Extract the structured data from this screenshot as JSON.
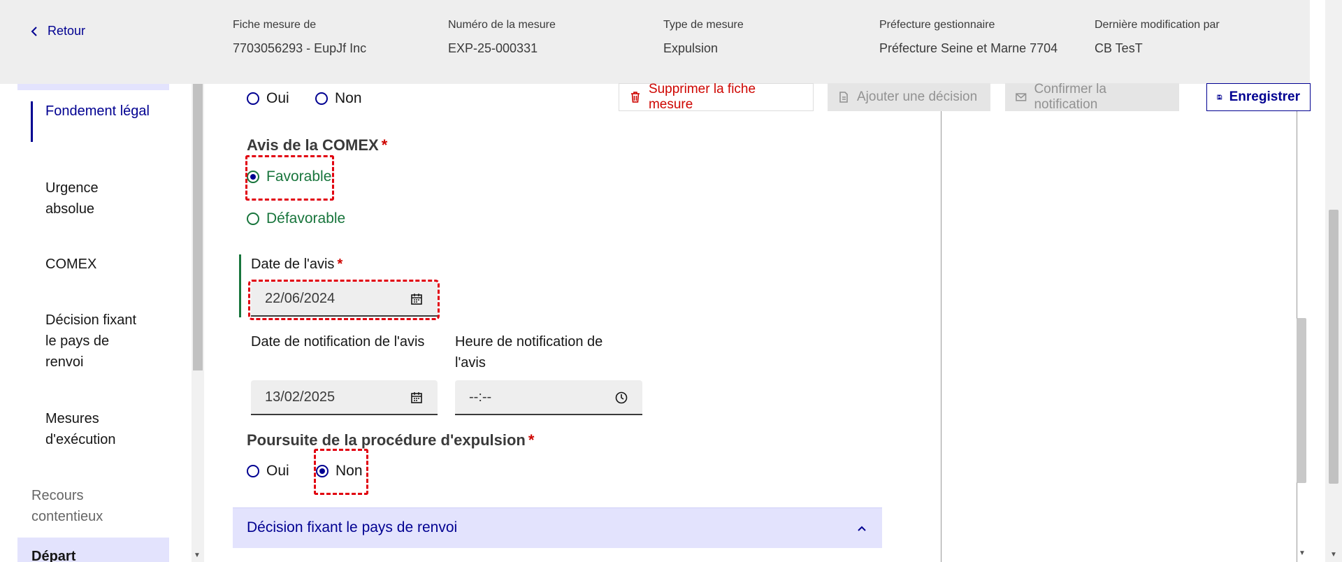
{
  "header": {
    "back_label": "Retour",
    "columns": [
      {
        "label": "Fiche mesure de",
        "value": "7703056293 - EupJf Inc"
      },
      {
        "label": "Numéro de la mesure",
        "value": "EXP-25-000331"
      },
      {
        "label": "Type de mesure",
        "value": "Expulsion"
      },
      {
        "label": "Préfecture gestionnaire",
        "value": "Préfecture Seine et Marne 7704"
      },
      {
        "label": "Dernière modification par",
        "value": "CB TesT"
      }
    ]
  },
  "sidebar": {
    "items": [
      {
        "label": "Fondement légal",
        "active": true
      },
      {
        "label": "Urgence absolue"
      },
      {
        "label": "COMEX"
      },
      {
        "label": "Décision fixant le pays de renvoi"
      },
      {
        "label": "Mesures d'exécution"
      }
    ],
    "section_recours": "Recours contentieux",
    "section_depart": "Départ"
  },
  "actions": {
    "delete": "Supprimer la fiche mesure",
    "add_decision": "Ajouter une décision",
    "confirm_notification": "Confirmer la notification",
    "save": "Enregistrer"
  },
  "form": {
    "top_radio": {
      "oui": "Oui",
      "non": "Non"
    },
    "comex_avis": {
      "legend": "Avis de la COMEX",
      "required_mark": "*",
      "options": [
        "Favorable",
        "Défavorable"
      ],
      "selected": "Favorable"
    },
    "date_avis": {
      "label": "Date de l'avis",
      "required_mark": "*",
      "value": "22/06/2024"
    },
    "date_notification": {
      "label": "Date de notification de l'avis",
      "value": "13/02/2025"
    },
    "heure_notification": {
      "label": "Heure de notification de l'avis",
      "value": "--:--"
    },
    "poursuite": {
      "legend": "Poursuite de la procédure d'expulsion",
      "required_mark": "*",
      "options": [
        "Oui",
        "Non"
      ],
      "selected": "Non"
    }
  },
  "accordion": {
    "title": "Décision fixant le pays de renvoi"
  },
  "colors": {
    "primary": "#000091",
    "success": "#18753c",
    "error": "#ce0500",
    "highlight": "#e1000f"
  }
}
